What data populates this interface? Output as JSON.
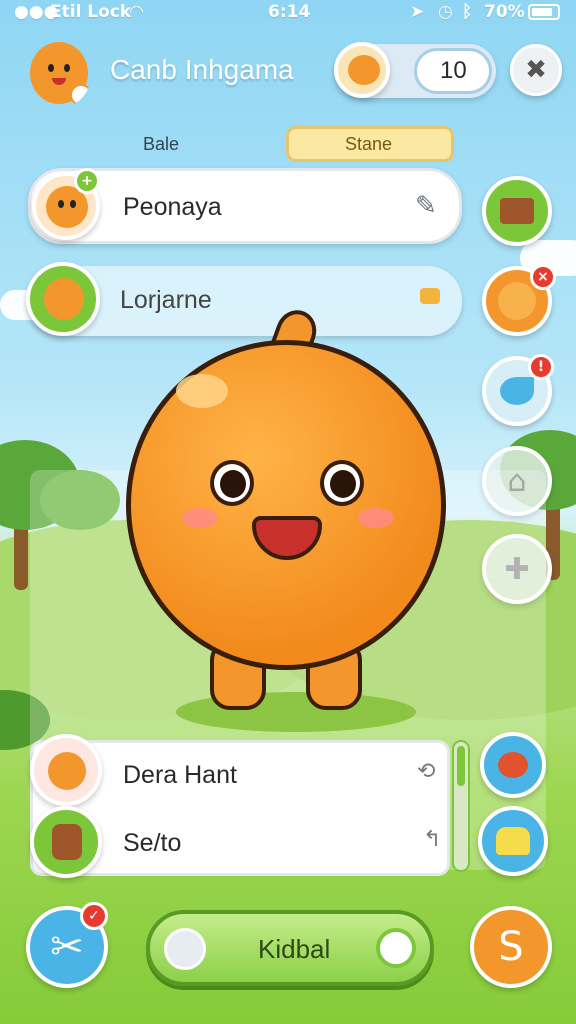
{
  "status_bar": {
    "carrier": "Etil Lock",
    "time": "6:14",
    "battery": "70%"
  },
  "header": {
    "title": "Canb Inhgama",
    "counter": "10"
  },
  "tabs": [
    {
      "label": "Bale",
      "active": false
    },
    {
      "label": "Stane",
      "active": true
    }
  ],
  "top_list": [
    {
      "name": "Peonaya",
      "action_icon": "pencil-icon"
    },
    {
      "name": "Lorjarne",
      "action_icon": "folder-icon"
    }
  ],
  "bottom_list": [
    {
      "name": "Dera Hant",
      "action_icon": "refresh-icon"
    },
    {
      "name": "Se/to",
      "action_icon": "share-icon"
    }
  ],
  "bottom_bar": {
    "center_label": "Kidbal"
  },
  "side_badges": [
    "×",
    "!"
  ],
  "colors": {
    "accent": "#f3962c",
    "green": "#7cc63a",
    "blue": "#4bb4e6",
    "badge": "#e63b2e"
  }
}
